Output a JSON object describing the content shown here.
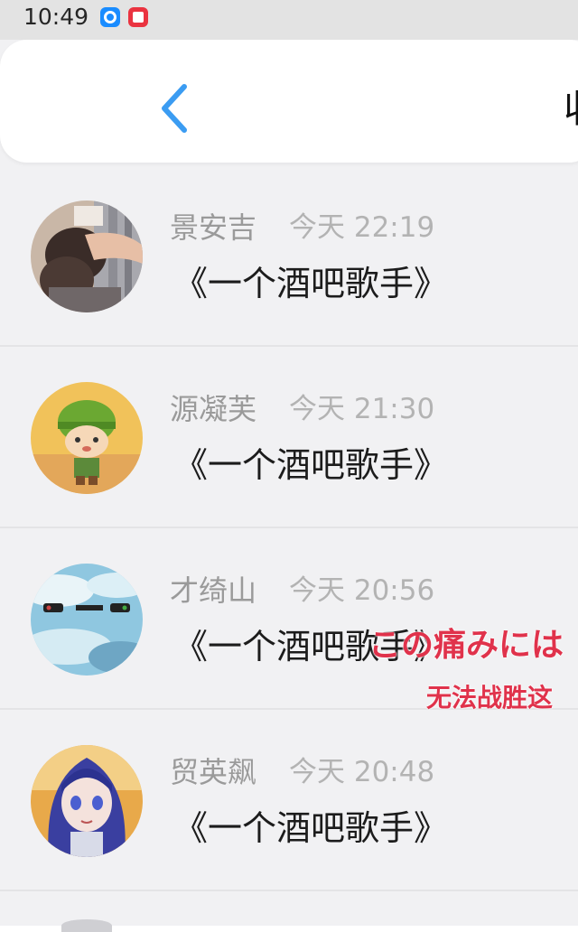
{
  "status_bar": {
    "time": "10:49",
    "icons": [
      "browser-app-icon",
      "red-app-icon"
    ]
  },
  "header": {
    "back_icon": "chevron-left-icon",
    "title_partial": "收",
    "accent_color": "#3b9cf2"
  },
  "items": [
    {
      "name": "景安吉",
      "time": "今天 22:19",
      "message": "《一个酒吧歌手》",
      "avatar": "photo-avatar"
    },
    {
      "name": "源凝芙",
      "time": "今天 21:30",
      "message": "《一个酒吧歌手》",
      "avatar": "cartoon-soldier-avatar"
    },
    {
      "name": "才绮山",
      "time": "今天 20:56",
      "message": "《一个酒吧歌手》",
      "avatar": "sky-traffic-light-avatar"
    },
    {
      "name": "贸英飙",
      "time": "今天 20:48",
      "message": "《一个酒吧歌手》",
      "avatar": "anime-girl-avatar"
    }
  ],
  "overlay": {
    "line1": "この痛みには",
    "line2": "无法战胜这",
    "color": "#e0324b"
  }
}
